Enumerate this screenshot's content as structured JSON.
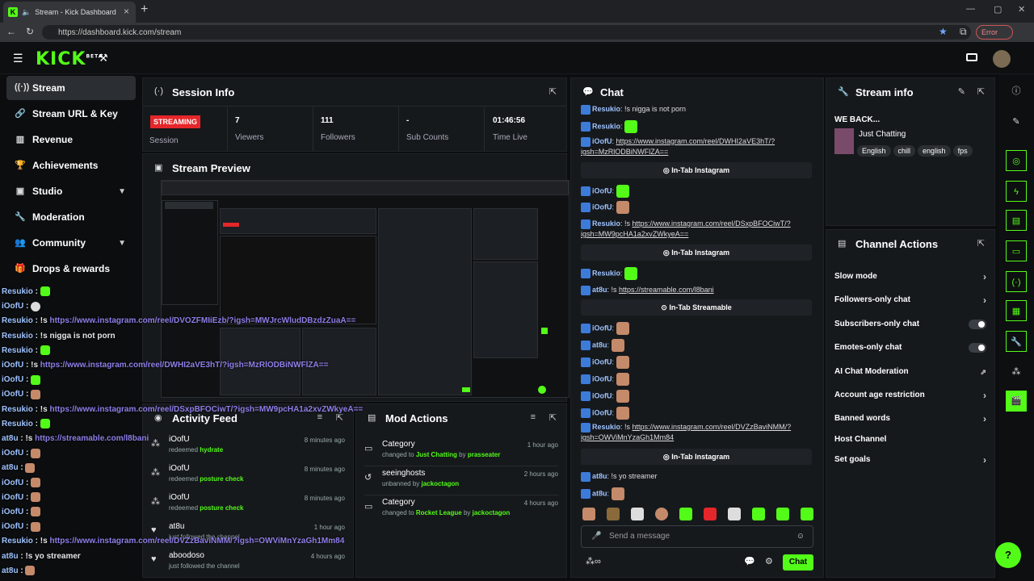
{
  "browser": {
    "tab_title": "Stream - Kick Dashboard",
    "url": "https://dashboard.kick.com/stream",
    "error_label": "Error"
  },
  "brand": {
    "logo": "KICK",
    "beta": "BETA"
  },
  "sidebar": {
    "items": [
      {
        "label": "Stream",
        "icon": "stream-icon"
      },
      {
        "label": "Stream URL & Key",
        "icon": "link-icon"
      },
      {
        "label": "Revenue",
        "icon": "revenue-icon"
      },
      {
        "label": "Achievements",
        "icon": "trophy-icon"
      },
      {
        "label": "Studio",
        "icon": "studio-icon"
      },
      {
        "label": "Moderation",
        "icon": "wrench-icon"
      },
      {
        "label": "Community",
        "icon": "community-icon"
      },
      {
        "label": "Drops & rewards",
        "icon": "gift-icon"
      }
    ]
  },
  "overlay_chat": [
    {
      "user": "Resukio",
      "text": "",
      "emote": "green"
    },
    {
      "user": "iOofU",
      "text": "",
      "emote": "white"
    },
    {
      "user": "Resukio",
      "text": "!s ",
      "link": "https://www.instagram.com/reel/DVOZFMIiEzb/?igsh=MWJrcWludDBzdzZuaA=="
    },
    {
      "user": "Resukio",
      "text": "!s nigga is not porn"
    },
    {
      "user": "Resukio",
      "text": "",
      "emote": "green"
    },
    {
      "user": "iOofU",
      "text": "!s ",
      "link": "https://www.instagram.com/reel/DWHI2aVE3hT/?igsh=MzRlODBiNWFlZA=="
    },
    {
      "user": "iOofU",
      "text": "",
      "emote": "green"
    },
    {
      "user": "iOofU",
      "text": "",
      "emote": "face"
    },
    {
      "user": "Resukio",
      "text": "!s ",
      "link": "https://www.instagram.com/reel/DSxpBFOCiwT/?igsh=MW9pcHA1a2xvZWkyeA=="
    },
    {
      "user": "Resukio",
      "text": "",
      "emote": "green"
    },
    {
      "user": "at8u",
      "text": "!s ",
      "link": "https://streamable.com/l8bani"
    },
    {
      "user": "iOofU",
      "text": "",
      "emote": "face"
    },
    {
      "user": "at8u",
      "text": "",
      "emote": "face"
    },
    {
      "user": "iOofU",
      "text": "",
      "emote": "face"
    },
    {
      "user": "iOofU",
      "text": "",
      "emote": "face"
    },
    {
      "user": "iOofU",
      "text": "",
      "emote": "face"
    },
    {
      "user": "iOofU",
      "text": "",
      "emote": "face"
    },
    {
      "user": "Resukio",
      "text": "!s ",
      "link": "https://www.instagram.com/reel/DVZzBaviNMM/?igsh=OWViMnYzaGh1Mm84"
    },
    {
      "user": "at8u",
      "text": "!s yo streamer"
    },
    {
      "user": "at8u",
      "text": "",
      "emote": "face"
    }
  ],
  "session": {
    "title": "Session Info",
    "badge": "STREAMING",
    "session_label": "Session",
    "stats": [
      {
        "value": "7",
        "label": "Viewers"
      },
      {
        "value": "111",
        "label": "Followers"
      },
      {
        "value": "-",
        "label": "Sub Counts"
      },
      {
        "value": "01:46:56",
        "label": "Time Live"
      }
    ]
  },
  "preview": {
    "title": "Stream Preview"
  },
  "activity": {
    "title": "Activity Feed",
    "items": [
      {
        "name": "iOofU",
        "action": "redeemed",
        "detail": "hydrate",
        "time": "8 minutes ago",
        "icon": "redeem-icon"
      },
      {
        "name": "iOofU",
        "action": "redeemed",
        "detail": "posture check",
        "time": "8 minutes ago",
        "icon": "redeem-icon"
      },
      {
        "name": "iOofU",
        "action": "redeemed",
        "detail": "posture check",
        "time": "8 minutes ago",
        "icon": "redeem-icon"
      },
      {
        "name": "at8u",
        "action": "just followed the channel",
        "detail": "",
        "time": "1 hour ago",
        "icon": "heart-icon"
      },
      {
        "name": "aboodoso",
        "action": "just followed the channel",
        "detail": "",
        "time": "4 hours ago",
        "icon": "heart-icon"
      }
    ]
  },
  "mod": {
    "title": "Mod Actions",
    "items": [
      {
        "name": "Category",
        "pre": "changed to ",
        "target": "Just Chatting",
        "mid": " by ",
        "by": "prasseater",
        "time": "1 hour ago"
      },
      {
        "name": "seeinghosts",
        "pre": "unbanned by ",
        "target": "",
        "mid": "",
        "by": "jackoctagon",
        "time": "2 hours ago"
      },
      {
        "name": "Category",
        "pre": "changed to ",
        "target": "Rocket League",
        "mid": " by ",
        "by": "jackoctagon",
        "time": "4 hours ago"
      }
    ]
  },
  "chat": {
    "title": "Chat",
    "input_placeholder": "Send a message",
    "send_label": "Chat",
    "lines": {
      "l0": {
        "user": "Resukio",
        "text": ": !s nigga is not porn"
      },
      "l1": {
        "user": "Resukio",
        "text": ":"
      },
      "l2": {
        "user": "iOofU",
        "text": ": ",
        "link": "https://www.instagram.com/reel/DWHI2aVE3hT/?igsh=MzRlODBiNWFlZA=="
      },
      "intab1": "In-Tab Instagram",
      "l3": {
        "user": "iOofU",
        "text": ":"
      },
      "l4": {
        "user": "iOofU",
        "text": ":"
      },
      "l5": {
        "user": "Resukio",
        "text": ": !s ",
        "link": "https://www.instagram.com/reel/DSxpBFOCiwT/?igsh=MW9pcHA1a2xvZWkyeA=="
      },
      "intab2": "In-Tab Instagram",
      "l6": {
        "user": "Resukio",
        "text": ":"
      },
      "l7": {
        "user": "at8u",
        "text": ": !s ",
        "link": "https://streamable.com/l8bani"
      },
      "intab3": "In-Tab Streamable",
      "l8": {
        "user": "iOofU",
        "text": ":"
      },
      "l9": {
        "user": "at8u",
        "text": ":"
      },
      "l10": {
        "user": "iOofU",
        "text": ":"
      },
      "l11": {
        "user": "iOofU",
        "text": ":"
      },
      "l12": {
        "user": "iOofU",
        "text": ":"
      },
      "l13": {
        "user": "iOofU",
        "text": ":"
      },
      "l14": {
        "user": "Resukio",
        "text": ": !s ",
        "link": "https://www.instagram.com/reel/DVZzBaviNMM/?igsh=OWViMnYzaGh1Mm84"
      },
      "intab4": "In-Tab Instagram",
      "l15": {
        "user": "at8u",
        "text": ": !s yo streamer"
      },
      "l16": {
        "user": "at8u",
        "text": ":"
      }
    }
  },
  "stream_info": {
    "title": "Stream info",
    "stream_title": "WE BACK...",
    "category": "Just Chatting",
    "tags": [
      "English",
      "chill",
      "english",
      "fps"
    ]
  },
  "channel_actions": {
    "title": "Channel Actions",
    "rows": [
      {
        "label": "Slow mode",
        "control": "chevron"
      },
      {
        "label": "Followers-only chat",
        "control": "chevron"
      },
      {
        "label": "Subscribers-only chat",
        "control": "toggle"
      },
      {
        "label": "Emotes-only chat",
        "control": "toggle"
      },
      {
        "label": "AI Chat Moderation",
        "control": "external"
      },
      {
        "label": "Account age restriction",
        "control": "chevron"
      },
      {
        "label": "Banned words",
        "control": "chevron"
      },
      {
        "label": "Host Channel",
        "control": "none"
      },
      {
        "label": "Set goals",
        "control": "chevron"
      }
    ]
  },
  "colors": {
    "accent": "#53fc18",
    "streaming": "#e5262a",
    "user": "#9ec3ff",
    "link": "#8f7ee8"
  }
}
